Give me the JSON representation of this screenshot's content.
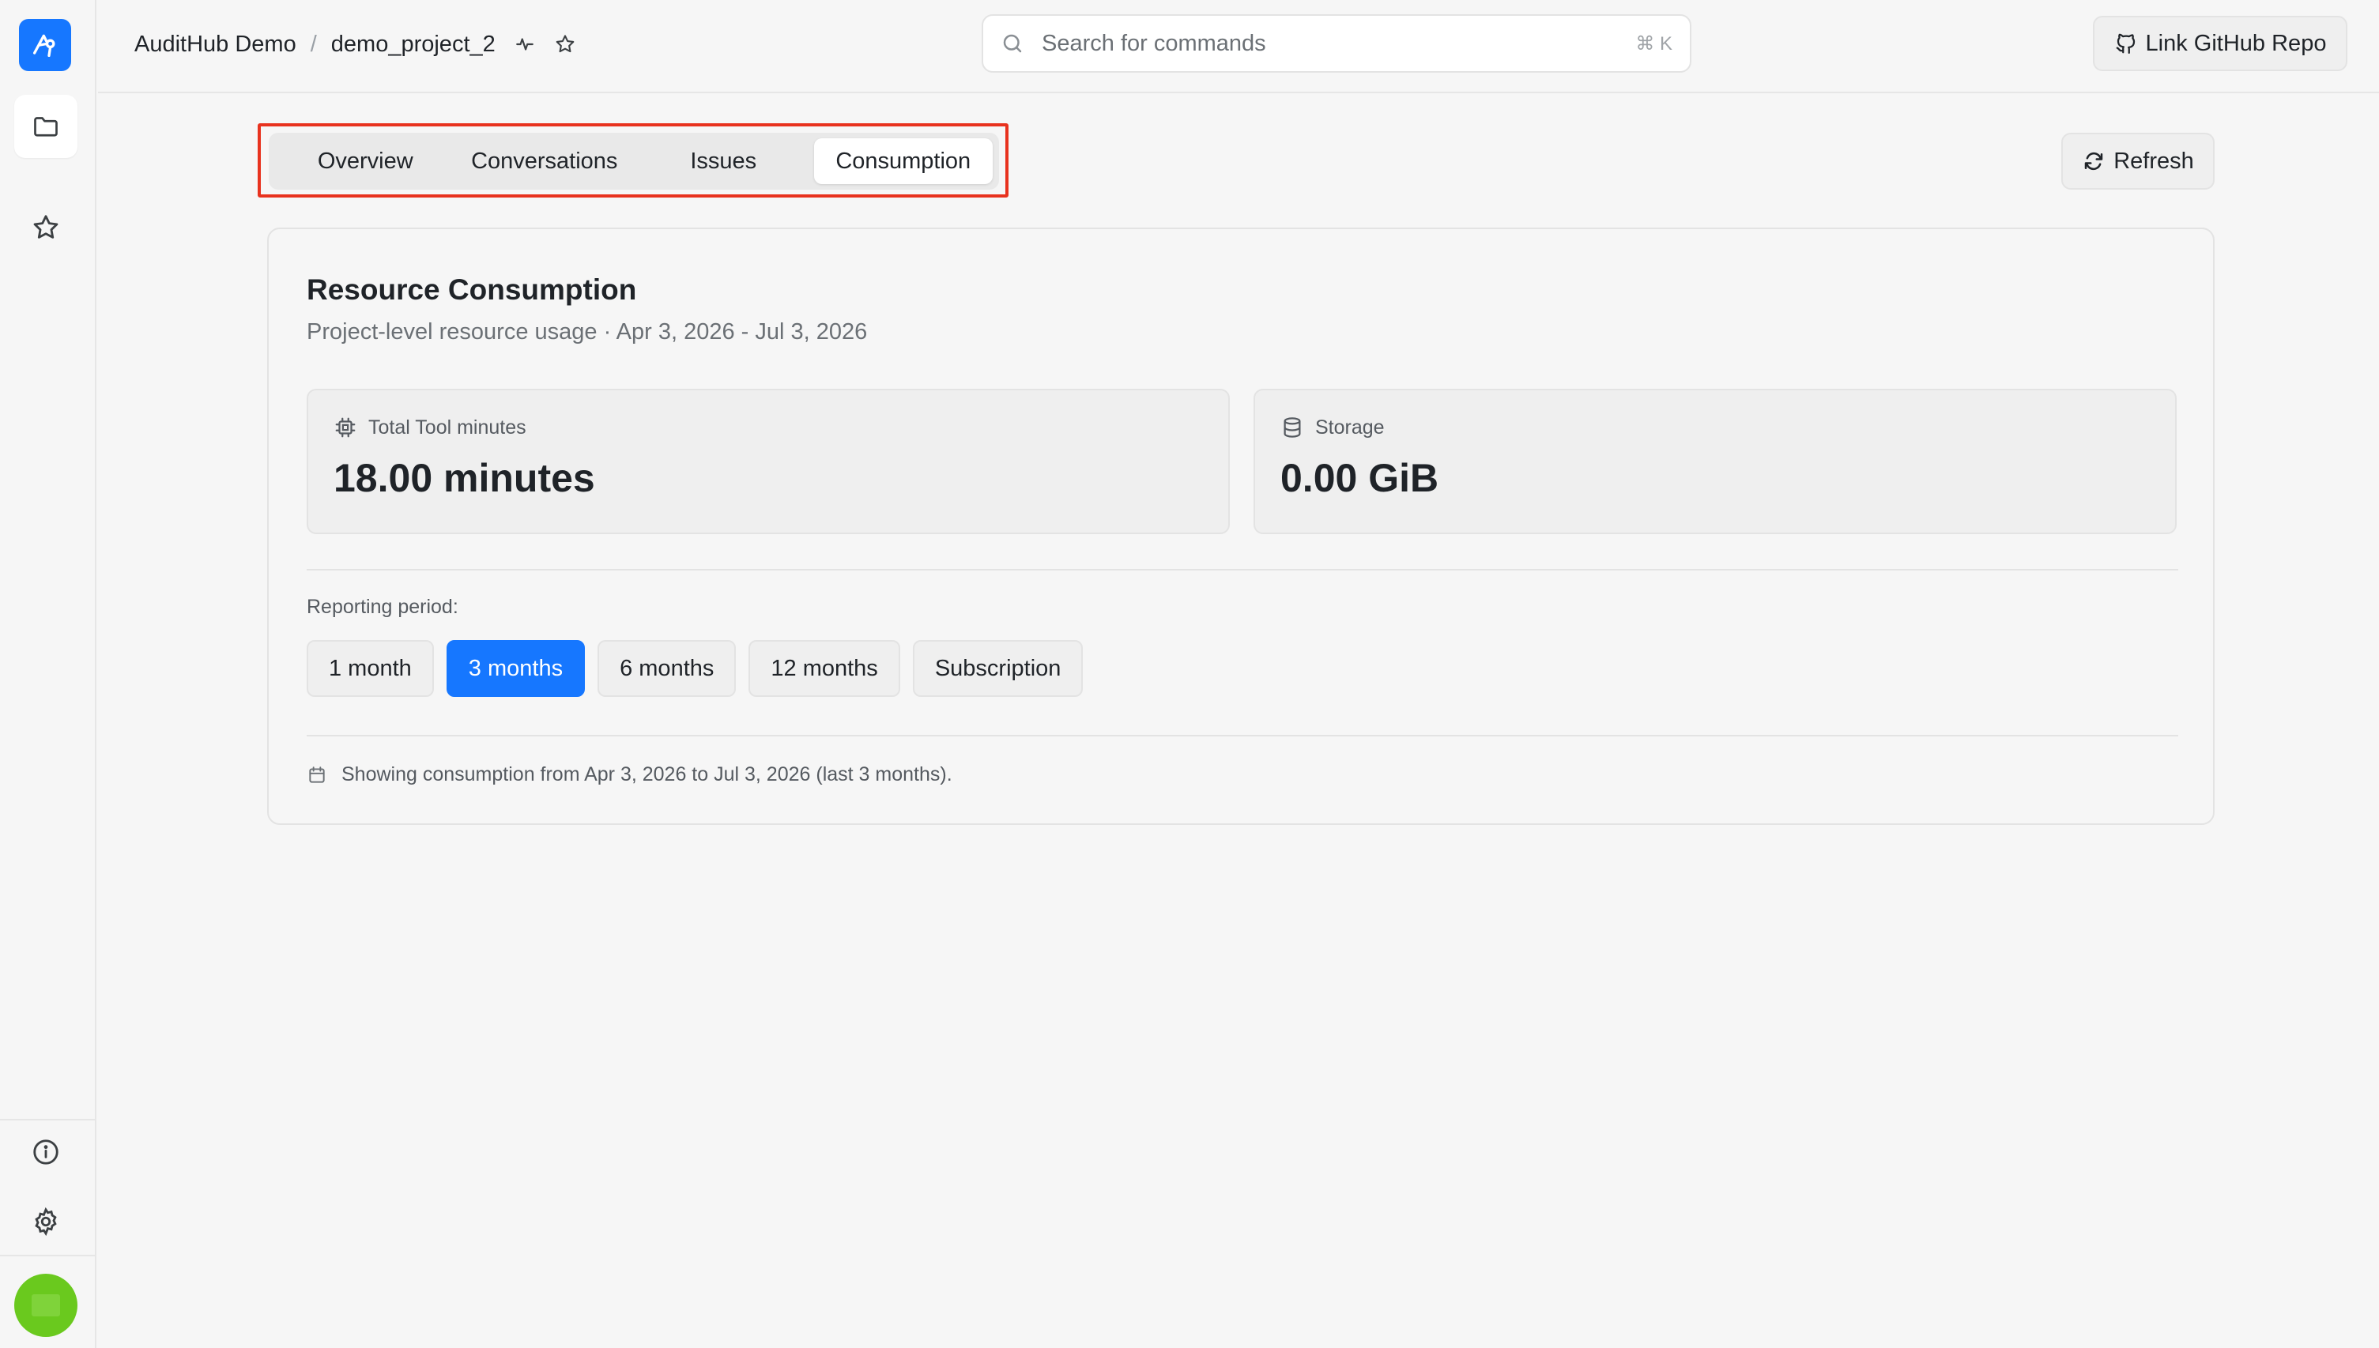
{
  "header": {
    "org": "AuditHub Demo",
    "separator": "/",
    "project": "demo_project_2",
    "search_placeholder": "Search for commands",
    "search_shortcut": "⌘ K",
    "github_button": "Link GitHub Repo"
  },
  "tabs": [
    {
      "label": "Overview",
      "active": false
    },
    {
      "label": "Conversations",
      "active": false
    },
    {
      "label": "Issues",
      "active": false
    },
    {
      "label": "Consumption",
      "active": true
    }
  ],
  "refresh_button": "Refresh",
  "card": {
    "title": "Resource Consumption",
    "subtitle": "Project-level resource usage · Apr 3, 2026 - Jul 3, 2026",
    "stats": [
      {
        "label": "Total Tool minutes",
        "value": "18.00 minutes",
        "icon": "cpu-icon"
      },
      {
        "label": "Storage",
        "value": "0.00 GiB",
        "icon": "database-icon"
      }
    ],
    "reporting_label": "Reporting period:",
    "periods": [
      {
        "label": "1 month",
        "active": false
      },
      {
        "label": "3 months",
        "active": true
      },
      {
        "label": "6 months",
        "active": false
      },
      {
        "label": "12 months",
        "active": false
      },
      {
        "label": "Subscription",
        "active": false
      }
    ],
    "showing_text": "Showing consumption from Apr 3, 2026 to Jul 3, 2026 (last 3 months)."
  },
  "colors": {
    "accent": "#1677ff",
    "highlight": "#e8321e",
    "avatar": "#6ac91e"
  }
}
